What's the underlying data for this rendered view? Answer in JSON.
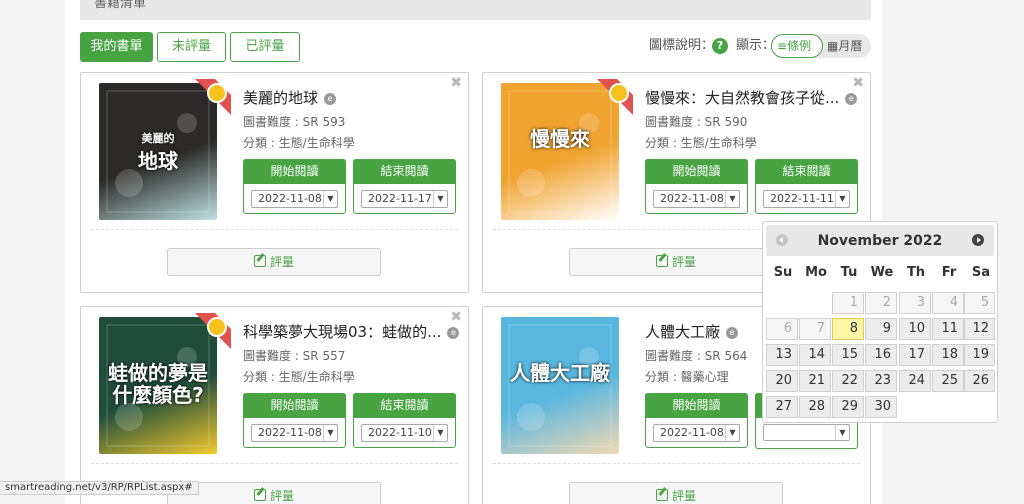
{
  "section": {
    "header": "書籍清單"
  },
  "tabs": [
    {
      "label": "我的書單",
      "active": true
    },
    {
      "label": "未評量",
      "active": false
    },
    {
      "label": "已評量",
      "active": false
    }
  ],
  "legend_label": "圖標說明：",
  "help_icon_glyph": "?",
  "display_label": "顯示：",
  "view_toggle": {
    "list": "條例",
    "calendar": "月曆",
    "list_icon": "list-icon",
    "calendar_icon": "calendar-icon"
  },
  "icons": {
    "close": "✖",
    "ebook": "e",
    "review": "pencil-icon",
    "award": "award-ribbon-icon",
    "dropdown": "▼"
  },
  "books": [
    {
      "title": "美麗的地球",
      "level": "圖書難度 : SR 593",
      "category": "分類 : 生態/生命科學",
      "start_label": "開始閱讀",
      "end_label": "結束閱讀",
      "start_date": "2022-11-08",
      "end_date": "2022-11-17",
      "review_label": "評量",
      "has_award": true,
      "cover_text": "地球",
      "cover_top": "美麗的",
      "cover_colors": [
        "#2b2a28",
        "#bfe3e1"
      ]
    },
    {
      "title": "慢慢來：大自然教會孩子從...",
      "level": "圖書難度 : SR 590",
      "category": "分類 : 生態/生命科學",
      "start_label": "開始閱讀",
      "end_label": "結束閱讀",
      "start_date": "2022-11-08",
      "end_date": "2022-11-11",
      "review_label": "評量",
      "has_award": true,
      "cover_text": "慢慢來",
      "cover_top": "",
      "cover_colors": [
        "#f0a32f",
        "#ffffff"
      ]
    },
    {
      "title": "科學築夢大現場03：蛙做的...",
      "level": "圖書難度 : SR 557",
      "category": "分類 : 生態/生命科學",
      "start_label": "開始閱讀",
      "end_label": "結束閱讀",
      "start_date": "2022-11-08",
      "end_date": "2022-11-10",
      "review_label": "評量",
      "has_award": true,
      "cover_text": "蛙做的夢是什麼顏色?",
      "cover_top": "",
      "cover_colors": [
        "#1f4d3a",
        "#f3c92e"
      ]
    },
    {
      "title": "人體大工廠",
      "level": "圖書難度 : SR 564",
      "category": "分類 : 醫藥心理",
      "start_label": "開始閱讀",
      "end_label": "結束閱讀",
      "start_date": "2022-11-08",
      "end_date": "",
      "review_label": "評量",
      "has_award": false,
      "cover_text": "人體大工廠",
      "cover_top": "",
      "cover_colors": [
        "#59b7df",
        "#f4d9b3"
      ]
    }
  ],
  "calendar": {
    "month_title": "November 2022",
    "weekdays": [
      "Su",
      "Mo",
      "Tu",
      "We",
      "Th",
      "Fr",
      "Sa"
    ],
    "today": 8,
    "dim_before": [
      1,
      2,
      3,
      4,
      5,
      6,
      7
    ],
    "first_weekday": 2,
    "days_in_month": 30
  },
  "status_url": "smartreading.net/v3/RP/RPList.aspx#"
}
